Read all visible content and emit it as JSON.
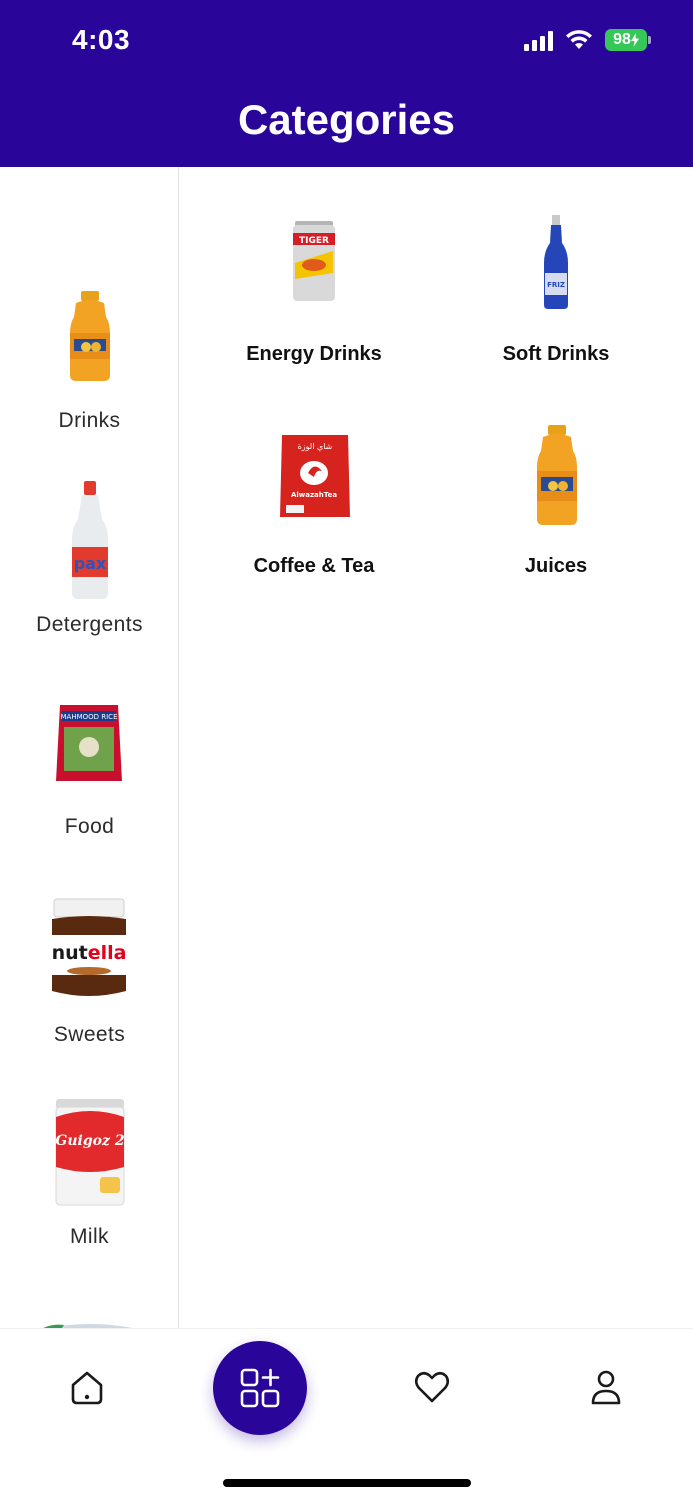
{
  "status_bar": {
    "time": "4:03",
    "battery": "98"
  },
  "header": {
    "title": "Categories"
  },
  "sidebar": {
    "items": [
      {
        "label": "Drinks"
      },
      {
        "label": "Detergents"
      },
      {
        "label": "Food"
      },
      {
        "label": "Sweets"
      },
      {
        "label": "Milk"
      }
    ]
  },
  "subcategories": [
    {
      "label": "Energy Drinks"
    },
    {
      "label": "Soft Drinks"
    },
    {
      "label": "Coffee & Tea"
    },
    {
      "label": "Juices"
    }
  ],
  "bottom_nav": {
    "items": [
      {
        "icon": "home-icon"
      },
      {
        "icon": "categories-icon",
        "active": true
      },
      {
        "icon": "heart-icon"
      },
      {
        "icon": "profile-icon"
      }
    ]
  },
  "colors": {
    "brand": "#2a0599",
    "battery": "#36c759"
  }
}
